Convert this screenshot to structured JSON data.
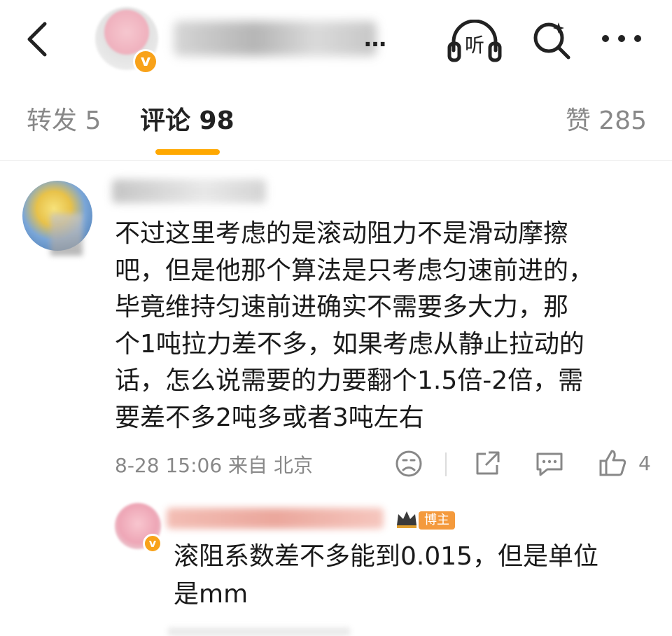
{
  "header": {
    "title_visible_suffix": "…",
    "icons": {
      "back": "back-arrow-icon",
      "listen": "listen-headphones-icon",
      "search": "search-icon",
      "more": "more-dots-icon",
      "verified": "verified-badge-icon"
    },
    "listen_label": "听",
    "verified_mark": "v"
  },
  "tabs": {
    "repost": "转发 5",
    "comments": "评论 98",
    "likes": "赞 285",
    "active": "comments",
    "accent_color": "#ffa800"
  },
  "comment": {
    "text": "不过这里考虑的是滚动阻力不是滑动摩擦\n吧，但是他那个算法是只考虑匀速前进的，\n毕竟维持匀速前进确实不需要多大力，那\n个1吨拉力差不多，如果考虑从静止拉动的\n话，怎么说需要的力要翻个1.5倍-2倍，需\n要差不多2吨多或者3吨左右",
    "time_location": "8-28 15:06 来自 北京",
    "like_count": "4",
    "actions": [
      "dislike-face-icon",
      "share-icon",
      "reply-icon",
      "like-thumb-icon"
    ]
  },
  "reply": {
    "owner_tag": "博主",
    "crown_icon": "crown-icon",
    "text": "滚阻系数差不多能到0.015，但是单位\n是mm"
  }
}
